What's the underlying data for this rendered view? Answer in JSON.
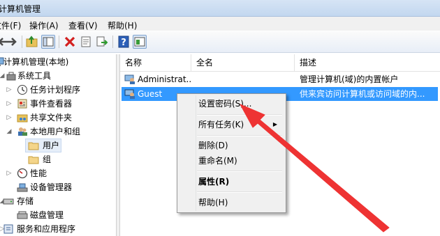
{
  "window": {
    "title": "计算机管理"
  },
  "menu": {
    "file": "文件(F)",
    "action": "操作(A)",
    "view": "查看(V)",
    "help": "帮助(H)"
  },
  "tree": {
    "root": "计算机管理(本地)",
    "system_tools": "系统工具",
    "task_scheduler": "任务计划程序",
    "event_viewer": "事件查看器",
    "shared_folders": "共享文件夹",
    "local_users_groups": "本地用户和组",
    "users": "用户",
    "groups": "组",
    "performance": "性能",
    "device_manager": "设备管理器",
    "storage": "存储",
    "disk_management": "磁盘管理",
    "services_apps": "服务和应用程序"
  },
  "list": {
    "headers": {
      "name": "名称",
      "fullname": "全名",
      "description": "描述"
    },
    "rows": [
      {
        "name": "Administrat...",
        "fullname": "",
        "description": "管理计算机(域)的内置帐户"
      },
      {
        "name": "Guest",
        "fullname": "",
        "description": "供来宾访问计算机或访问域的内..."
      }
    ]
  },
  "context_menu": {
    "set_password": "设置密码(S)...",
    "all_tasks": "所有任务(K)",
    "delete": "删除(D)",
    "rename": "重命名(M)",
    "properties": "属性(R)",
    "help": "帮助(H)"
  },
  "colors": {
    "selection": "#3399ff",
    "annotation_arrow": "#ee3333"
  },
  "icons": [
    "back-arrow-icon",
    "forward-arrow-icon",
    "up-folder-icon",
    "show-hide-tree-icon",
    "delete-icon",
    "properties-icon",
    "export-icon",
    "help-icon",
    "action-pane-icon",
    "user-icon",
    "folder-icon",
    "clock-icon",
    "event-icon",
    "share-icon",
    "users-group-icon",
    "performance-icon",
    "device-manager-icon",
    "storage-icon",
    "disk-icon",
    "services-icon",
    "computer-icon",
    "tools-icon"
  ]
}
